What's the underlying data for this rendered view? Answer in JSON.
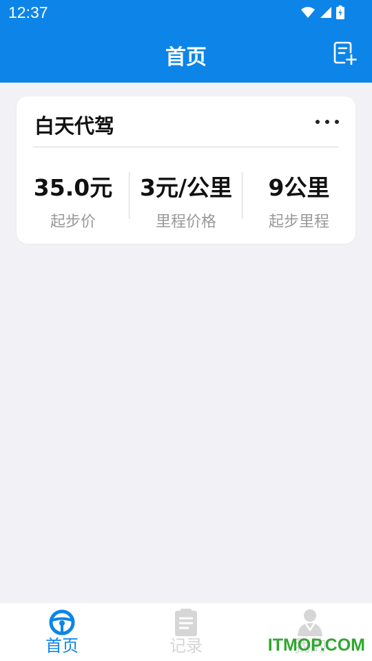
{
  "status_bar": {
    "time": "12:37",
    "icons": [
      "wifi-icon",
      "cell-signal-icon",
      "battery-charging-icon"
    ]
  },
  "header": {
    "title": "首页",
    "action_icon": "add-order-icon"
  },
  "service_card": {
    "title": "白天代驾",
    "menu_icon": "more-icon",
    "stats": [
      {
        "value": "35.0元",
        "label": "起步价"
      },
      {
        "value": "3元/公里",
        "label": "里程价格"
      },
      {
        "value": "9公里",
        "label": "起步里程"
      }
    ]
  },
  "bottom_nav": {
    "items": [
      {
        "label": "首页",
        "icon": "steering-wheel-icon",
        "active": true
      },
      {
        "label": "记录",
        "icon": "clipboard-icon",
        "active": false
      },
      {
        "label": "我的",
        "icon": "user-icon",
        "active": false
      }
    ]
  },
  "watermark": "ITMOP.COM",
  "colors": {
    "primary": "#0d85e8",
    "background": "#f2f2f6",
    "inactive": "#d6d6d6",
    "watermark": "#2fa72f"
  }
}
